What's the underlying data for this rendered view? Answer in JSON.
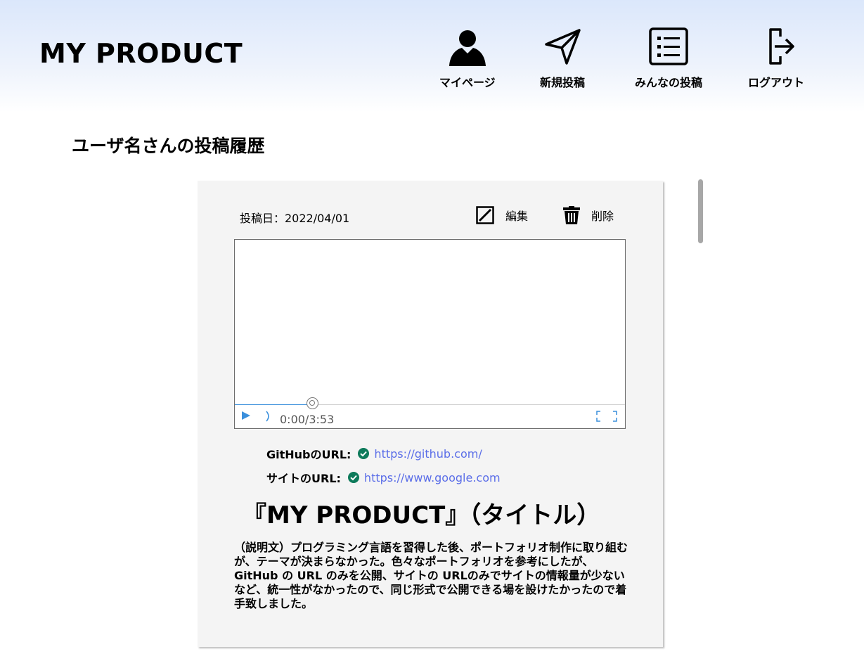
{
  "header": {
    "brand": "MY PRODUCT",
    "nav": [
      {
        "label": "マイページ",
        "icon": "user-icon"
      },
      {
        "label": "新規投稿",
        "icon": "send-icon"
      },
      {
        "label": "みんなの投稿",
        "icon": "list-icon"
      },
      {
        "label": "ログアウト",
        "icon": "logout-icon"
      }
    ]
  },
  "page": {
    "history_title": "ユーザ名さんの投稿履歴"
  },
  "post": {
    "date": "投稿日：2022/04/01",
    "edit_label": "編集",
    "delete_label": "削除",
    "video": {
      "time": "0:00/3:53",
      "progress": 0.2
    },
    "github_label": "GitHubのURL:",
    "github_url": "https://github.com/",
    "site_label": "サイトのURL:",
    "site_url": "https://www.google.com",
    "title": "『MY PRODUCT』（タイトル）",
    "description": "（説明文）プログラミング言語を習得した後、ポートフォリオ制作に取り組むが、テーマが決まらなかった。色々なポートフォリオを参考にしたが、GitHub の URL のみを公開、サイトの URLのみでサイトの情報量が少ないなど、統一性がなかったので、同じ形式で公開できる場を設けたかったので着手致しました。"
  },
  "colors": {
    "header_gradient_top": "#dbe7fb",
    "link": "#5b6ee8",
    "check": "#0d7a5a",
    "play": "#3a8fdc"
  }
}
